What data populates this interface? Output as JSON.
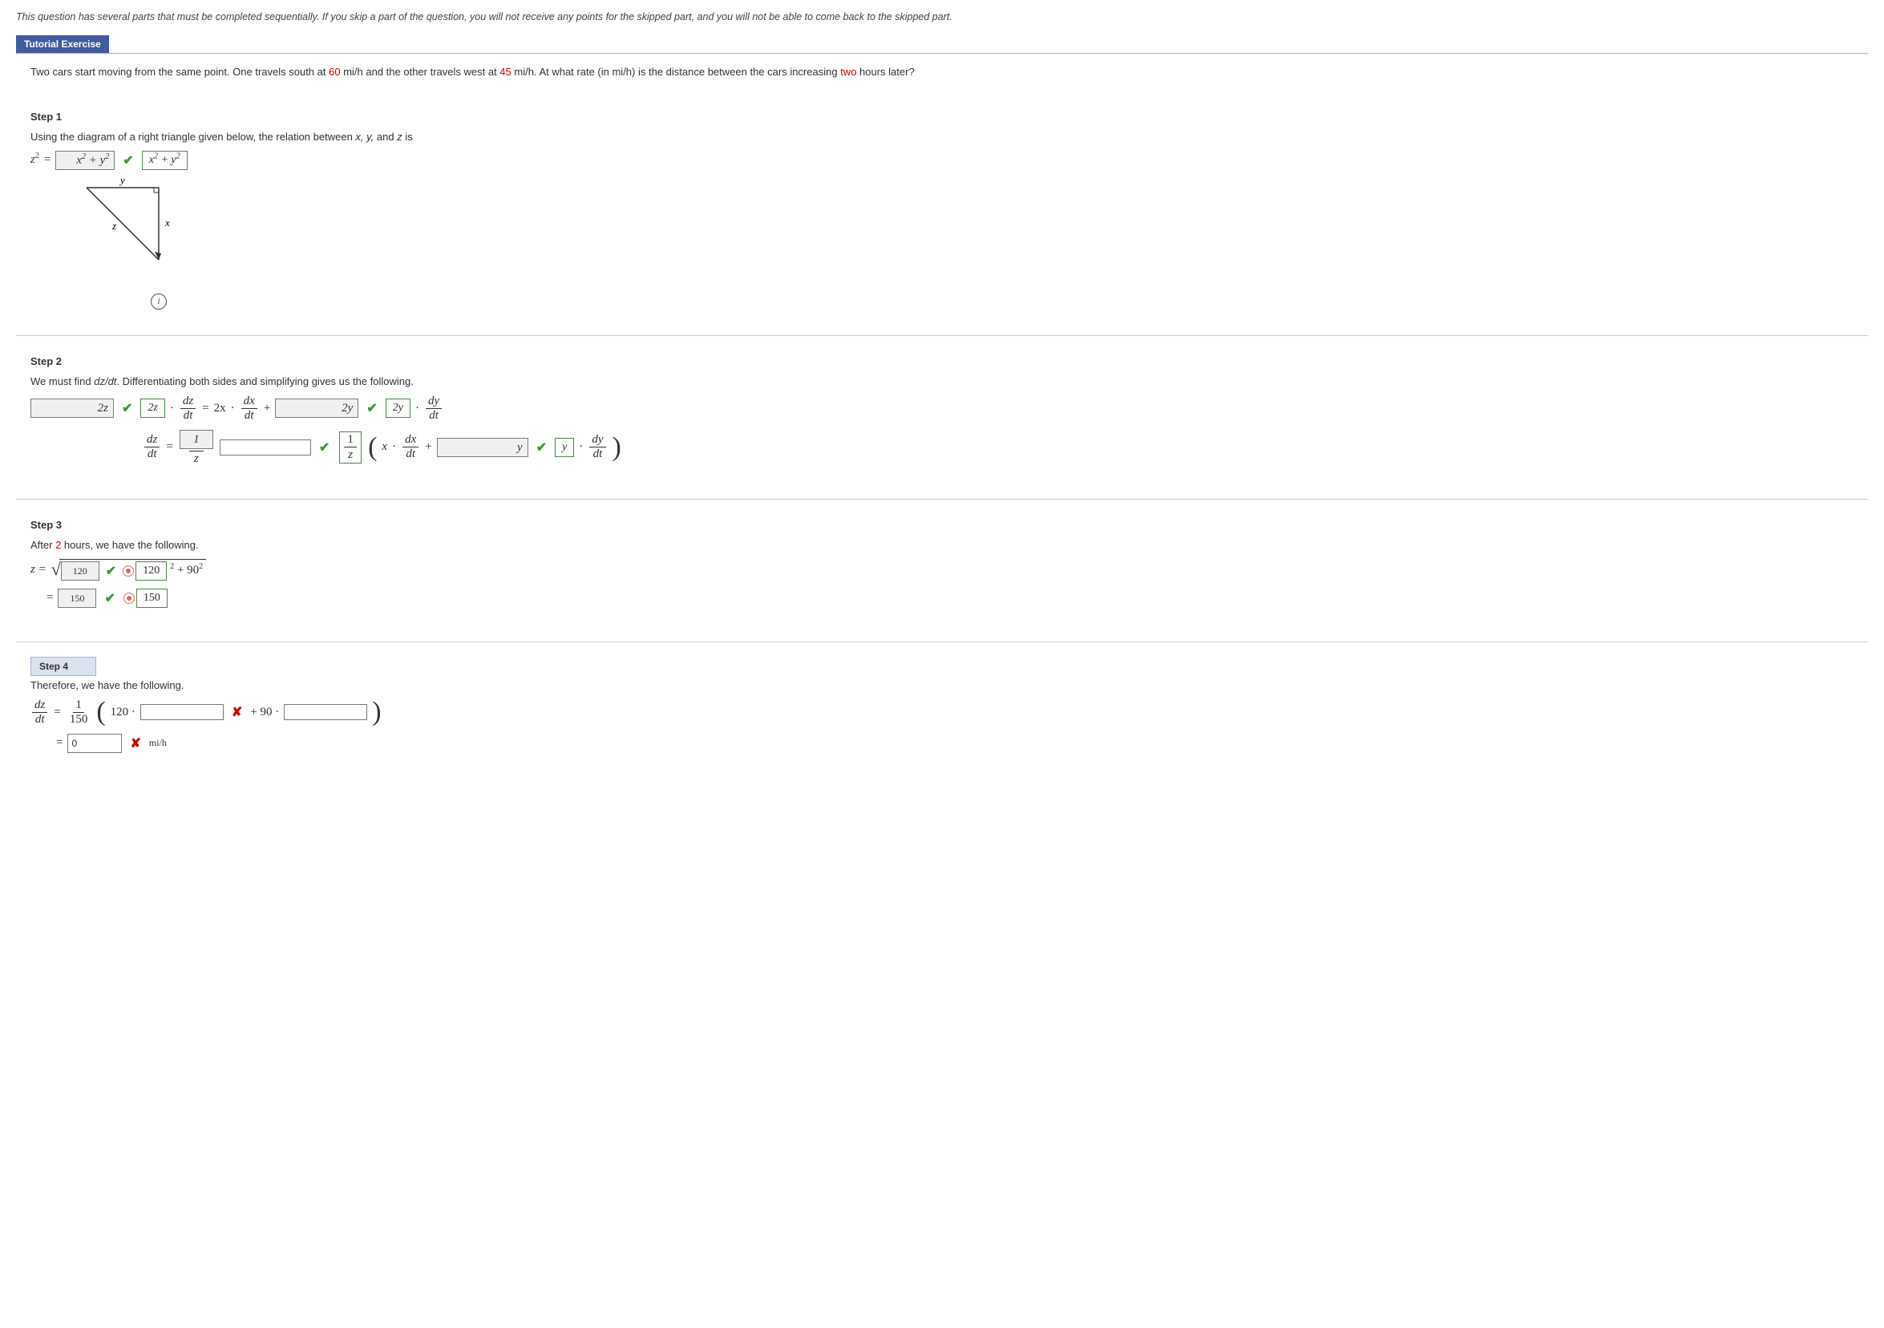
{
  "instructions": "This question has several parts that must be completed sequentially. If you skip a part of the question, you will not receive any points for the skipped part, and you will not be able to come back to the skipped part.",
  "tutorial_bar": "Tutorial Exercise",
  "problem": {
    "pre1": "Two cars start moving from the same point. One travels south at ",
    "v1": "60",
    "mid1": " mi/h and the other travels west at ",
    "v2": "45",
    "mid2": " mi/h. At what rate (in mi/h) is the distance between the cars increasing ",
    "v3": "two",
    "post": " hours later?"
  },
  "step1": {
    "title": "Step 1",
    "text_pre": "Using the diagram of a right triangle given below, the relation between ",
    "vars": "x, y, ",
    "text_mid": "and ",
    "varz": "z ",
    "text_post": "is",
    "lhs": "z",
    "lhs_exp": "2",
    "eq": "=",
    "input_html": "x<sup>2</sup> + y<sup>2</sup>",
    "solution_html": "x<sup>2</sup> + y<sup>2</sup>",
    "labels": {
      "x": "x",
      "y": "y",
      "z": "z"
    }
  },
  "step2": {
    "title": "Step 2",
    "text": "We must find dz/dt. Differentiating both sides and simplifying gives us the following.",
    "line1": {
      "in1": "2z",
      "sol1": "2z",
      "frac1_num": "dz",
      "frac1_den": "dt",
      "coef2": "2x",
      "frac2_num": "dx",
      "frac2_den": "dt",
      "in2": "2y",
      "sol2": "2y",
      "frac3_num": "dy",
      "frac3_den": "dt"
    },
    "line2": {
      "frac_lhs_num": "dz",
      "frac_lhs_den": "dt",
      "num_box": "1",
      "den_var": "z",
      "sol_num": "1",
      "sol_den": "z",
      "x_var": "x",
      "frac_dx_num": "dx",
      "frac_dx_den": "dt",
      "in_y": "y",
      "sol_y": "y",
      "frac_dy_num": "dy",
      "frac_dy_den": "dt"
    }
  },
  "step3": {
    "title": "Step 3",
    "text_pre": "After ",
    "hours": "2",
    "text_post": " hours, we have the following.",
    "z_eq": "z  =",
    "in1": "120",
    "sol1": "120",
    "sq_tail": " + 90",
    "sq_exp": "2",
    "sol_exp": "2",
    "eq2": "=",
    "in2": "150",
    "sol2": "150"
  },
  "step4": {
    "title": "Step 4",
    "text": "Therefore, we have the following.",
    "frac_num": "dz",
    "frac_den": "dt",
    "coef_num": "1",
    "coef_den": "150",
    "open": "(",
    "v120": "120 ·",
    "plus": "+ 90 ·",
    "close": ")",
    "eq2": "=",
    "in_final": "0",
    "unit": "mi/h"
  }
}
